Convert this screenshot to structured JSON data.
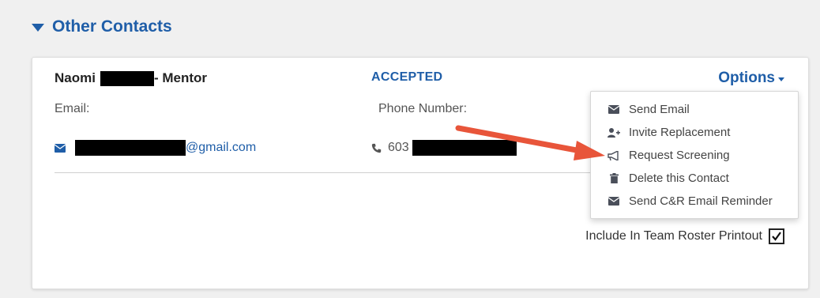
{
  "section": {
    "title": "Other Contacts",
    "icon": "caret-down-icon"
  },
  "contact": {
    "first_name": "Naomi",
    "role_suffix": "- Mentor",
    "status": "ACCEPTED",
    "email_label": "Email:",
    "email_domain": "@gmail.com",
    "phone_label": "Phone Number:",
    "phone_prefix": "603",
    "include_roster_label": "Include In Team Roster Printout",
    "include_roster_checked": true
  },
  "options": {
    "label": "Options",
    "menu": [
      {
        "label": "Send Email",
        "icon": "envelope-icon"
      },
      {
        "label": "Invite Replacement",
        "icon": "user-plus-icon"
      },
      {
        "label": "Request Screening",
        "icon": "bullhorn-icon"
      },
      {
        "label": "Delete this Contact",
        "icon": "trash-icon"
      },
      {
        "label": "Send C&R Email Reminder",
        "icon": "envelope-icon"
      }
    ]
  },
  "annotation": {
    "arrow_color": "#e8553a"
  },
  "colors": {
    "accent": "#1f5ea8",
    "background": "#f0f0f0",
    "card": "#ffffff"
  }
}
